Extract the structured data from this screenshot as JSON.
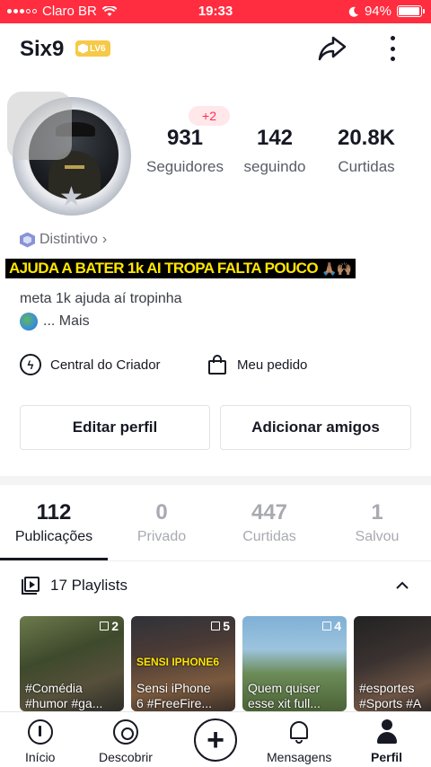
{
  "status_bar": {
    "carrier": "Claro BR",
    "time": "19:33",
    "battery_percent": "94%",
    "battery_level": 0.94
  },
  "profile": {
    "username": "Six9",
    "level": "LV6",
    "followers_delta": "+2",
    "stats": [
      {
        "value": "931",
        "label": "Seguidores"
      },
      {
        "value": "142",
        "label": "seguindo"
      },
      {
        "value": "20.8K",
        "label": "Curtidas"
      }
    ],
    "badge_link": "Distintivo",
    "caption_overlay": "AJUDA A BATER 1k AI TROPA FALTA POUCO",
    "caption_emojis": "🙏🏽🙌🏽",
    "bio_line1": "meta 1k ajuda aí tropinha",
    "bio_line2": "... Mais"
  },
  "actions": {
    "creator_center": "Central do Criador",
    "my_order": "Meu pedido",
    "edit_profile": "Editar perfil",
    "add_friends": "Adicionar amigos"
  },
  "tabs": [
    {
      "value": "112",
      "label": "Publicações"
    },
    {
      "value": "0",
      "label": "Privado"
    },
    {
      "value": "447",
      "label": "Curtidas"
    },
    {
      "value": "1",
      "label": "Salvou"
    }
  ],
  "playlists": {
    "header": "17 Playlists",
    "items": [
      {
        "count": "2",
        "title_line1": "#Comédia",
        "title_line2": "#humor #ga..."
      },
      {
        "count": "5",
        "overlay": "SENSI IPHONE6",
        "title_line1": "Sensi iPhone",
        "title_line2": "6 #FreeFire..."
      },
      {
        "count": "4",
        "title_line1": "Quem quiser",
        "title_line2": "esse xit full..."
      },
      {
        "count": "",
        "title_line1": "#esportes",
        "title_line2": "#Sports #A"
      }
    ]
  },
  "bottom_nav": {
    "home": "Início",
    "discover": "Descobrir",
    "create": "+",
    "messages": "Mensagens",
    "profile": "Perfil"
  },
  "colors": {
    "status_bar": "#ff2d3f",
    "accent": "#fe2c55",
    "level_badge": "#f7c948",
    "caption_text": "#ffe600"
  }
}
